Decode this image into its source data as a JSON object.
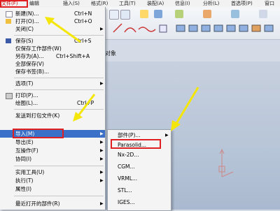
{
  "menubar": {
    "items": [
      {
        "label": "文件(F)"
      },
      {
        "label": "编辑"
      },
      {
        "label": "插入(S)"
      },
      {
        "label": "格式(R)"
      },
      {
        "label": "工具(T)"
      },
      {
        "label": "装配(A)"
      },
      {
        "label": "信息(I)"
      },
      {
        "label": "分析(L)"
      },
      {
        "label": "首选项(P)"
      },
      {
        "label": "窗口"
      }
    ]
  },
  "context_label": "对象",
  "file_menu": {
    "items": [
      {
        "label": "新建(N)...",
        "shortcut": "Ctrl+N",
        "icon": "new-file-icon"
      },
      {
        "label": "打开(O)...",
        "shortcut": "Ctrl+O",
        "icon": "open-folder-icon"
      },
      {
        "label": "关闭(C)",
        "shortcut": "",
        "submenu": true
      },
      {
        "label": "保存(S)",
        "shortcut": "Ctrl+S",
        "icon": "save-icon"
      },
      {
        "label": "仅保存工作部件(W)",
        "shortcut": ""
      },
      {
        "label": "另存为(A)...",
        "shortcut": "Ctrl+Shift+A"
      },
      {
        "label": "全部保存(V)",
        "shortcut": ""
      },
      {
        "label": "保存书签(B)...",
        "shortcut": ""
      },
      {
        "label": "选项(T)",
        "shortcut": "",
        "submenu": true
      },
      {
        "label": "打印(P)...",
        "shortcut": "",
        "icon": "print-icon"
      },
      {
        "label": "绘图(L)...",
        "shortcut": "Ctrl+P"
      },
      {
        "label": "发送到打包文件(K)",
        "shortcut": ""
      },
      {
        "label": "导入(M)",
        "shortcut": "",
        "submenu": true,
        "highlighted": true
      },
      {
        "label": "导出(E)",
        "shortcut": "",
        "submenu": true
      },
      {
        "label": "互操作(F)",
        "shortcut": "",
        "submenu": true
      },
      {
        "label": "协同(I)",
        "shortcut": "",
        "submenu": true
      },
      {
        "label": "实用工具(U)",
        "shortcut": "",
        "submenu": true
      },
      {
        "label": "执行(T)",
        "shortcut": "",
        "submenu": true
      },
      {
        "label": "属性(I)",
        "shortcut": ""
      },
      {
        "label": "最近打开的部件(R)",
        "shortcut": "",
        "submenu": true
      }
    ]
  },
  "import_submenu": {
    "items": [
      {
        "label": "部件(P)..."
      },
      {
        "label": "Parasolid..."
      },
      {
        "label": "Nx-2D..."
      },
      {
        "label": "CGM..."
      },
      {
        "label": "VRML..."
      },
      {
        "label": "STL..."
      },
      {
        "label": "IGES..."
      }
    ]
  },
  "colors": {
    "highlight": "#3a70c8",
    "annotation_red": "#e02020",
    "annotation_arrow": "#f5e60a"
  }
}
